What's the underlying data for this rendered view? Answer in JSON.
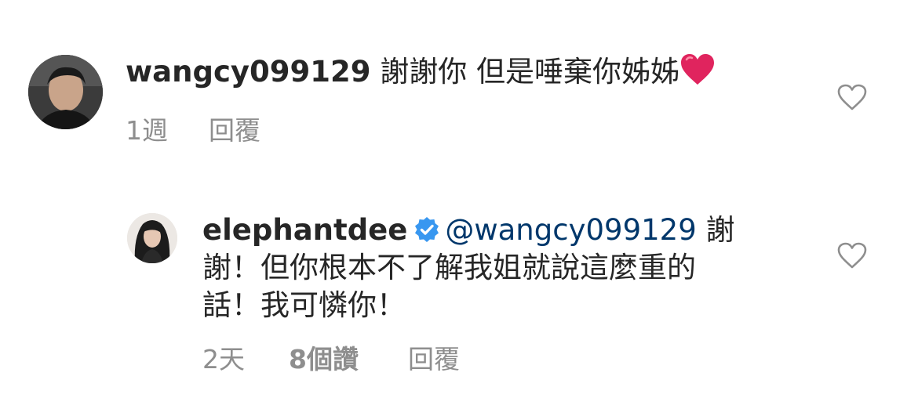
{
  "comments": [
    {
      "username": "wangcy099129",
      "text": "謝謝你 但是唾棄你姊姊",
      "emoji": "red-heart",
      "time": "1週",
      "reply_label": "回覆"
    },
    {
      "username": "elephantdee",
      "verified": true,
      "mention": "@wangcy099129",
      "text_line1_end": "謝",
      "text_line2": "謝！但你根本不了解我姐就說這麼重的",
      "text_line3": "話！我可憐你！",
      "time": "2天",
      "likes": "8個讚",
      "reply_label": "回覆"
    }
  ],
  "colors": {
    "text": "#262626",
    "meta": "#8e8e8e",
    "mention": "#00376b",
    "verified": "#3897f0",
    "heart_emoji": "#e0245e"
  }
}
